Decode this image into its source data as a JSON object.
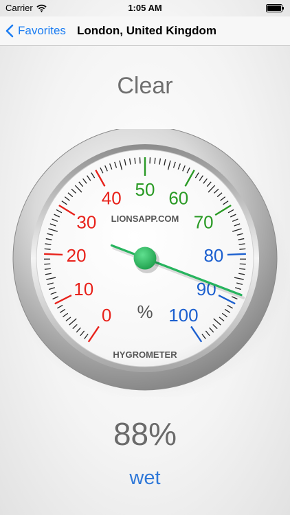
{
  "status_bar": {
    "carrier": "Carrier",
    "time": "1:05 AM",
    "wifi_icon": "wifi-icon",
    "battery_icon": "battery-icon"
  },
  "nav": {
    "back_label": "Favorites",
    "back_icon": "chevron-left-icon",
    "title": "London, United Kingdom"
  },
  "weather": {
    "condition": "Clear"
  },
  "gauge": {
    "brand": "LIONSAPP.COM",
    "unit": "%",
    "name": "HYGROMETER",
    "min": 0,
    "max": 100,
    "value": 88,
    "scale_labels": [
      "0",
      "10",
      "20",
      "30",
      "40",
      "50",
      "60",
      "70",
      "80",
      "90",
      "100"
    ],
    "zones": [
      {
        "from": 0,
        "to": 45,
        "color": "#e8221b"
      },
      {
        "from": 45,
        "to": 75,
        "color": "#2a9a25"
      },
      {
        "from": 75,
        "to": 100,
        "color": "#1b5fcf"
      }
    ],
    "needle_color": "#27b45e",
    "tick_color": "#222222"
  },
  "readout": {
    "value": "88%",
    "descriptor": "wet"
  }
}
